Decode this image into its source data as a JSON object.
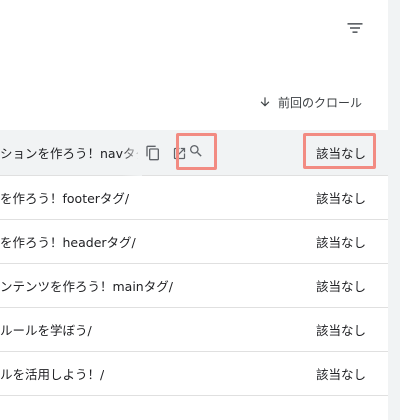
{
  "toolbar": {
    "filter_icon": "filter-list-icon"
  },
  "table": {
    "sort_label": "前回のクロール",
    "sort_icon": "arrow-down-icon",
    "rows": [
      {
        "url": "ションを作ろう！navタグ",
        "status": "該当なし"
      },
      {
        "url": "を作ろう！footerタグ/",
        "status": "該当なし"
      },
      {
        "url": "を作ろう！headerタグ/",
        "status": "該当なし"
      },
      {
        "url": "ンテンツを作ろう！mainタグ/",
        "status": "該当なし"
      },
      {
        "url": "ルールを学ぼう/",
        "status": "該当なし"
      },
      {
        "url": "ルを活用しよう！/",
        "status": "該当なし"
      }
    ],
    "row_action_icons": [
      "copy-icon",
      "open-in-new-icon",
      "search-icon"
    ]
  },
  "colors": {
    "highlight": "#f28b82",
    "hover_row": "#f1f3f4",
    "divider": "#e0e0e0"
  }
}
